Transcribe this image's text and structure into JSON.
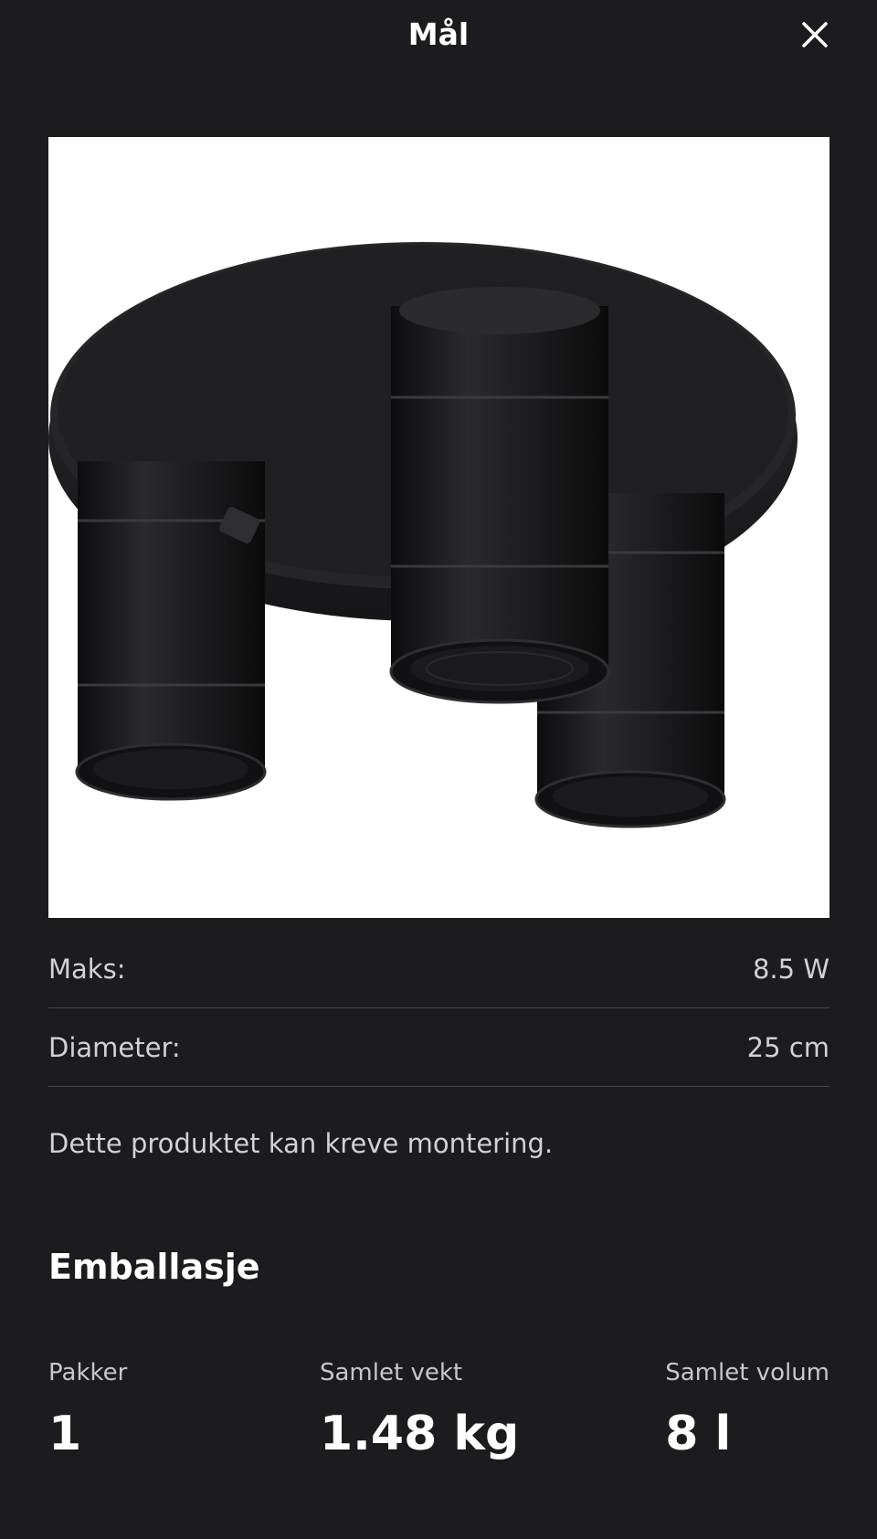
{
  "header": {
    "title": "Mål",
    "close_icon": "close-icon"
  },
  "product": {
    "image_description": "black ceiling spotlight with three spots"
  },
  "specs": [
    {
      "label": "Maks:",
      "value": "8.5 W"
    },
    {
      "label": "Diameter:",
      "value": "25 cm"
    }
  ],
  "note": "Dette produktet kan kreve montering.",
  "packaging": {
    "title": "Emballasje",
    "items": [
      {
        "label": "Pakker",
        "value": "1"
      },
      {
        "label": "Samlet vekt",
        "value": "1.48 kg"
      },
      {
        "label": "Samlet volum",
        "value": "8 l"
      }
    ]
  },
  "colors": {
    "background": "#1c1c1e",
    "divider": "#48484a",
    "text_secondary": "#d1d1d6"
  }
}
